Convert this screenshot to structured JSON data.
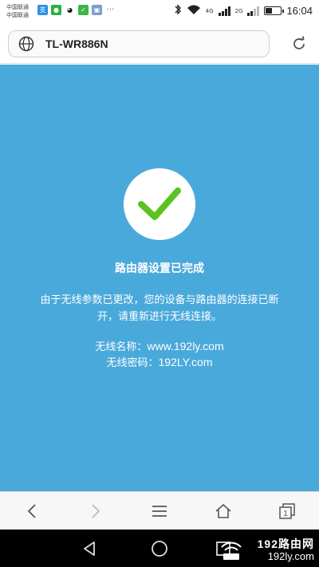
{
  "status_bar": {
    "carrier_line1": "中国联通",
    "carrier_line2": "中国联通",
    "network_label_1": "4G",
    "network_label_2": "2G",
    "time": "16:04",
    "notification_icons": [
      "alipay-icon",
      "wechat-icon",
      "qq-icon",
      "app-icon",
      "gallery-icon",
      "more-icon"
    ]
  },
  "address_bar": {
    "url_text": "TL-WR886N"
  },
  "page": {
    "title": "路由器设置已完成",
    "description": "由于无线参数已更改，您的设备与路由器的连接已断开，请重新进行无线连接。",
    "ssid_label": "无线名称：",
    "ssid_value": "www.192ly.com",
    "password_label": "无线密码：",
    "password_value": "192LY.com",
    "accent_color": "#4aa9db",
    "check_color": "#5cc21f"
  },
  "toolbar": {
    "items": [
      "back-icon",
      "forward-icon",
      "menu-icon",
      "home-icon",
      "tabs-icon"
    ],
    "tabs_count": "1"
  },
  "watermark": {
    "top": "192路由网",
    "bottom": "192ly.com"
  }
}
